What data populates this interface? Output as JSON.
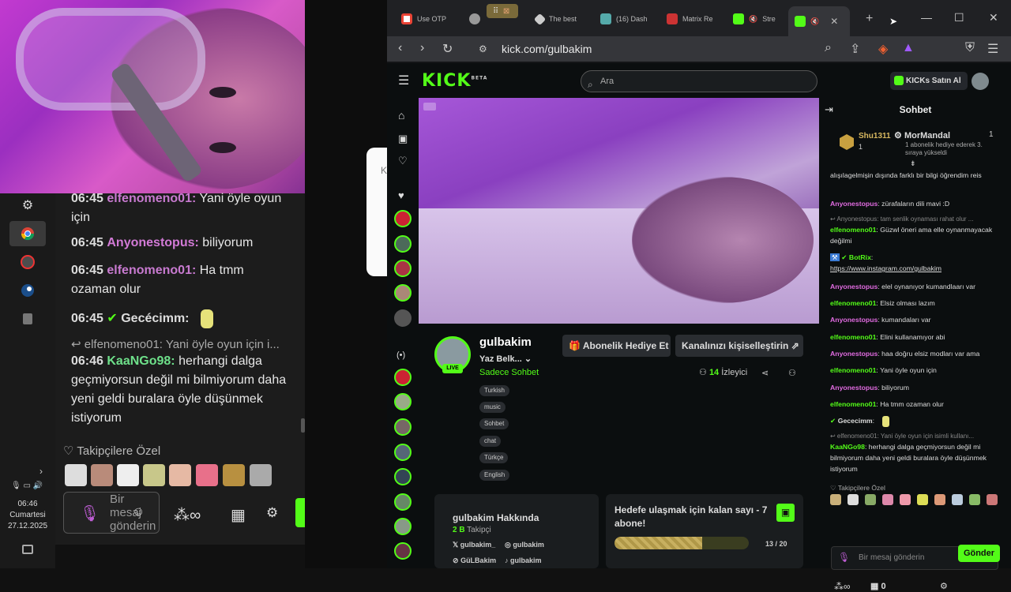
{
  "taskbar": {
    "clock_time": "06:46",
    "clock_day": "Cumartesi",
    "clock_date": "27.12.2025"
  },
  "left_chat": {
    "messages": [
      {
        "time": "06:45",
        "user": "elfenomeno01:",
        "text": "Yani öyle oyun için"
      },
      {
        "time": "06:45",
        "user": "Anyonestopus:",
        "text": "biliyorum"
      },
      {
        "time": "06:45",
        "user": "elfenomeno01:",
        "text": "Ha tmm ozaman olur"
      },
      {
        "time": "06:45",
        "user": "Gecécimm:",
        "text": ""
      },
      {
        "reply": "↩ elfenomeno01: Yani öyle oyun için i..."
      },
      {
        "time": "06:46",
        "user": "KaaNGo98:",
        "text": "herhangi dalga geçmiyorsun değil mi bilmiyorum daha yeni geldi buralara öyle düşünmek istiyorum"
      }
    ],
    "followers_label": "Takipçilere Özel",
    "input_placeholder": "Bir mesaj gönderin"
  },
  "browser": {
    "tabs": [
      {
        "label": "Use OTP"
      },
      {
        "label": ""
      },
      {
        "label": "The best"
      },
      {
        "label": "(16) Dash"
      },
      {
        "label": "Matrix Re"
      },
      {
        "label": "Stre"
      },
      {
        "label": ""
      }
    ],
    "url": "kick.com/gulbakim"
  },
  "kick": {
    "logo": "KICK",
    "logo_beta": "BETA",
    "search_placeholder": "Ara",
    "buy_kicks": "KICKs Satın Al",
    "channel": {
      "name": "gulbakim",
      "live": "LIVE",
      "title": "Yaz Belk...",
      "category": "Sadece Sohbet",
      "tags": [
        "Turkish",
        "music",
        "Sohbet",
        "chat",
        "Türkçe",
        "English"
      ],
      "gift_sub": "Abonelik Hediye Et",
      "customize": "Kanalınızı kişiselleştirin",
      "viewers_count": "14",
      "viewers_label": "İzleyici"
    },
    "about": {
      "title": "gulbakim Hakkında",
      "followers_count": "2 B",
      "followers_label": "Takipçi",
      "socials": [
        "gulbakim_",
        "gulbakim",
        "GüLBakim",
        "gulbakim"
      ]
    },
    "goal": {
      "title": "Hedefe ulaşmak için kalan sayı - 7 abone!",
      "progress_text": "13 / 20",
      "progress": 0.65
    },
    "chat": {
      "title": "Sohbet",
      "pinned_user1": "Shu1311",
      "pinned_user1_count": "1",
      "pinned_user2": "MorMandal",
      "pinned_user2_count": "1",
      "pinned_text": "1 abonelik hediye ederek 3. sıraya yükseldi",
      "messages": [
        {
          "user": "",
          "text": "alışılagelmişin dışında farklı bir bilgi öğrendim reis"
        },
        {
          "user": "Anyonestopus",
          "text": "zürafaların dili mavi :D"
        },
        {
          "reply": "↩ Anyonestopus: tam senlik oynaması rahat olur ..."
        },
        {
          "user": "elfenomeno01",
          "text": "Güzwl öneri ama elle oynanmayacak değilmi"
        },
        {
          "user": "BotRix",
          "text": "https://www.instagram.com/gulbakim"
        },
        {
          "user": "Anyonestopus",
          "text": "elel oynanıyor kumandlaarı var"
        },
        {
          "user": "elfenomeno01",
          "text": "Elsiz olması lazım"
        },
        {
          "user": "Anyonestopus",
          "text": "kumandaları var"
        },
        {
          "user": "elfenomeno01",
          "text": "Elini kullanamıyor abi"
        },
        {
          "user": "Anyonestopus",
          "text": "haa doğru elsiz modları var ama"
        },
        {
          "user": "elfenomeno01",
          "text": "Yani öyle oyun için"
        },
        {
          "user": "Anyonestopus",
          "text": "biliyorum"
        },
        {
          "user": "elfenomeno01",
          "text": "Ha tmm ozaman olur"
        },
        {
          "user": "Gececimm",
          "text": ""
        },
        {
          "reply": "↩ elfenomeno01: Yani öyle oyun için isimli kullanı..."
        },
        {
          "user": "KaaNGo98",
          "text": "herhangi dalga geçmiyorsun değil mi bilmiyorum daha yeni geldi buralara öyle düşünmek istiyorum"
        }
      ],
      "followers_only": "Takipçilere Özel",
      "input_placeholder": "Bir mesaj gönderin",
      "kicks_count": "0",
      "send": "Gönder"
    }
  }
}
